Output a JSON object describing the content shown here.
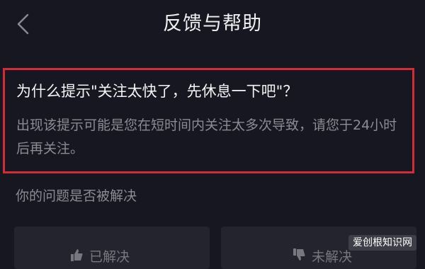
{
  "header": {
    "back_icon": "chevron-left-icon",
    "title": "反馈与帮助"
  },
  "faq": {
    "question": "为什么提示\"关注太快了，先休息一下吧\"？",
    "answer": "出现该提示可能是您在短时间内关注太多次导致，请您于24小时后再关注。"
  },
  "feedback": {
    "prompt": "你的问题是否被解决",
    "resolved_label": "已解决",
    "unresolved_label": "未解决",
    "resolved_icon": "thumbs-up-icon",
    "unresolved_icon": "thumbs-down-icon"
  },
  "watermark": {
    "text": "爱创根知识网"
  },
  "colors": {
    "background": "#171722",
    "highlight_border": "#d42c36",
    "button_bg": "#24242f",
    "muted_text": "#8b8b93"
  }
}
